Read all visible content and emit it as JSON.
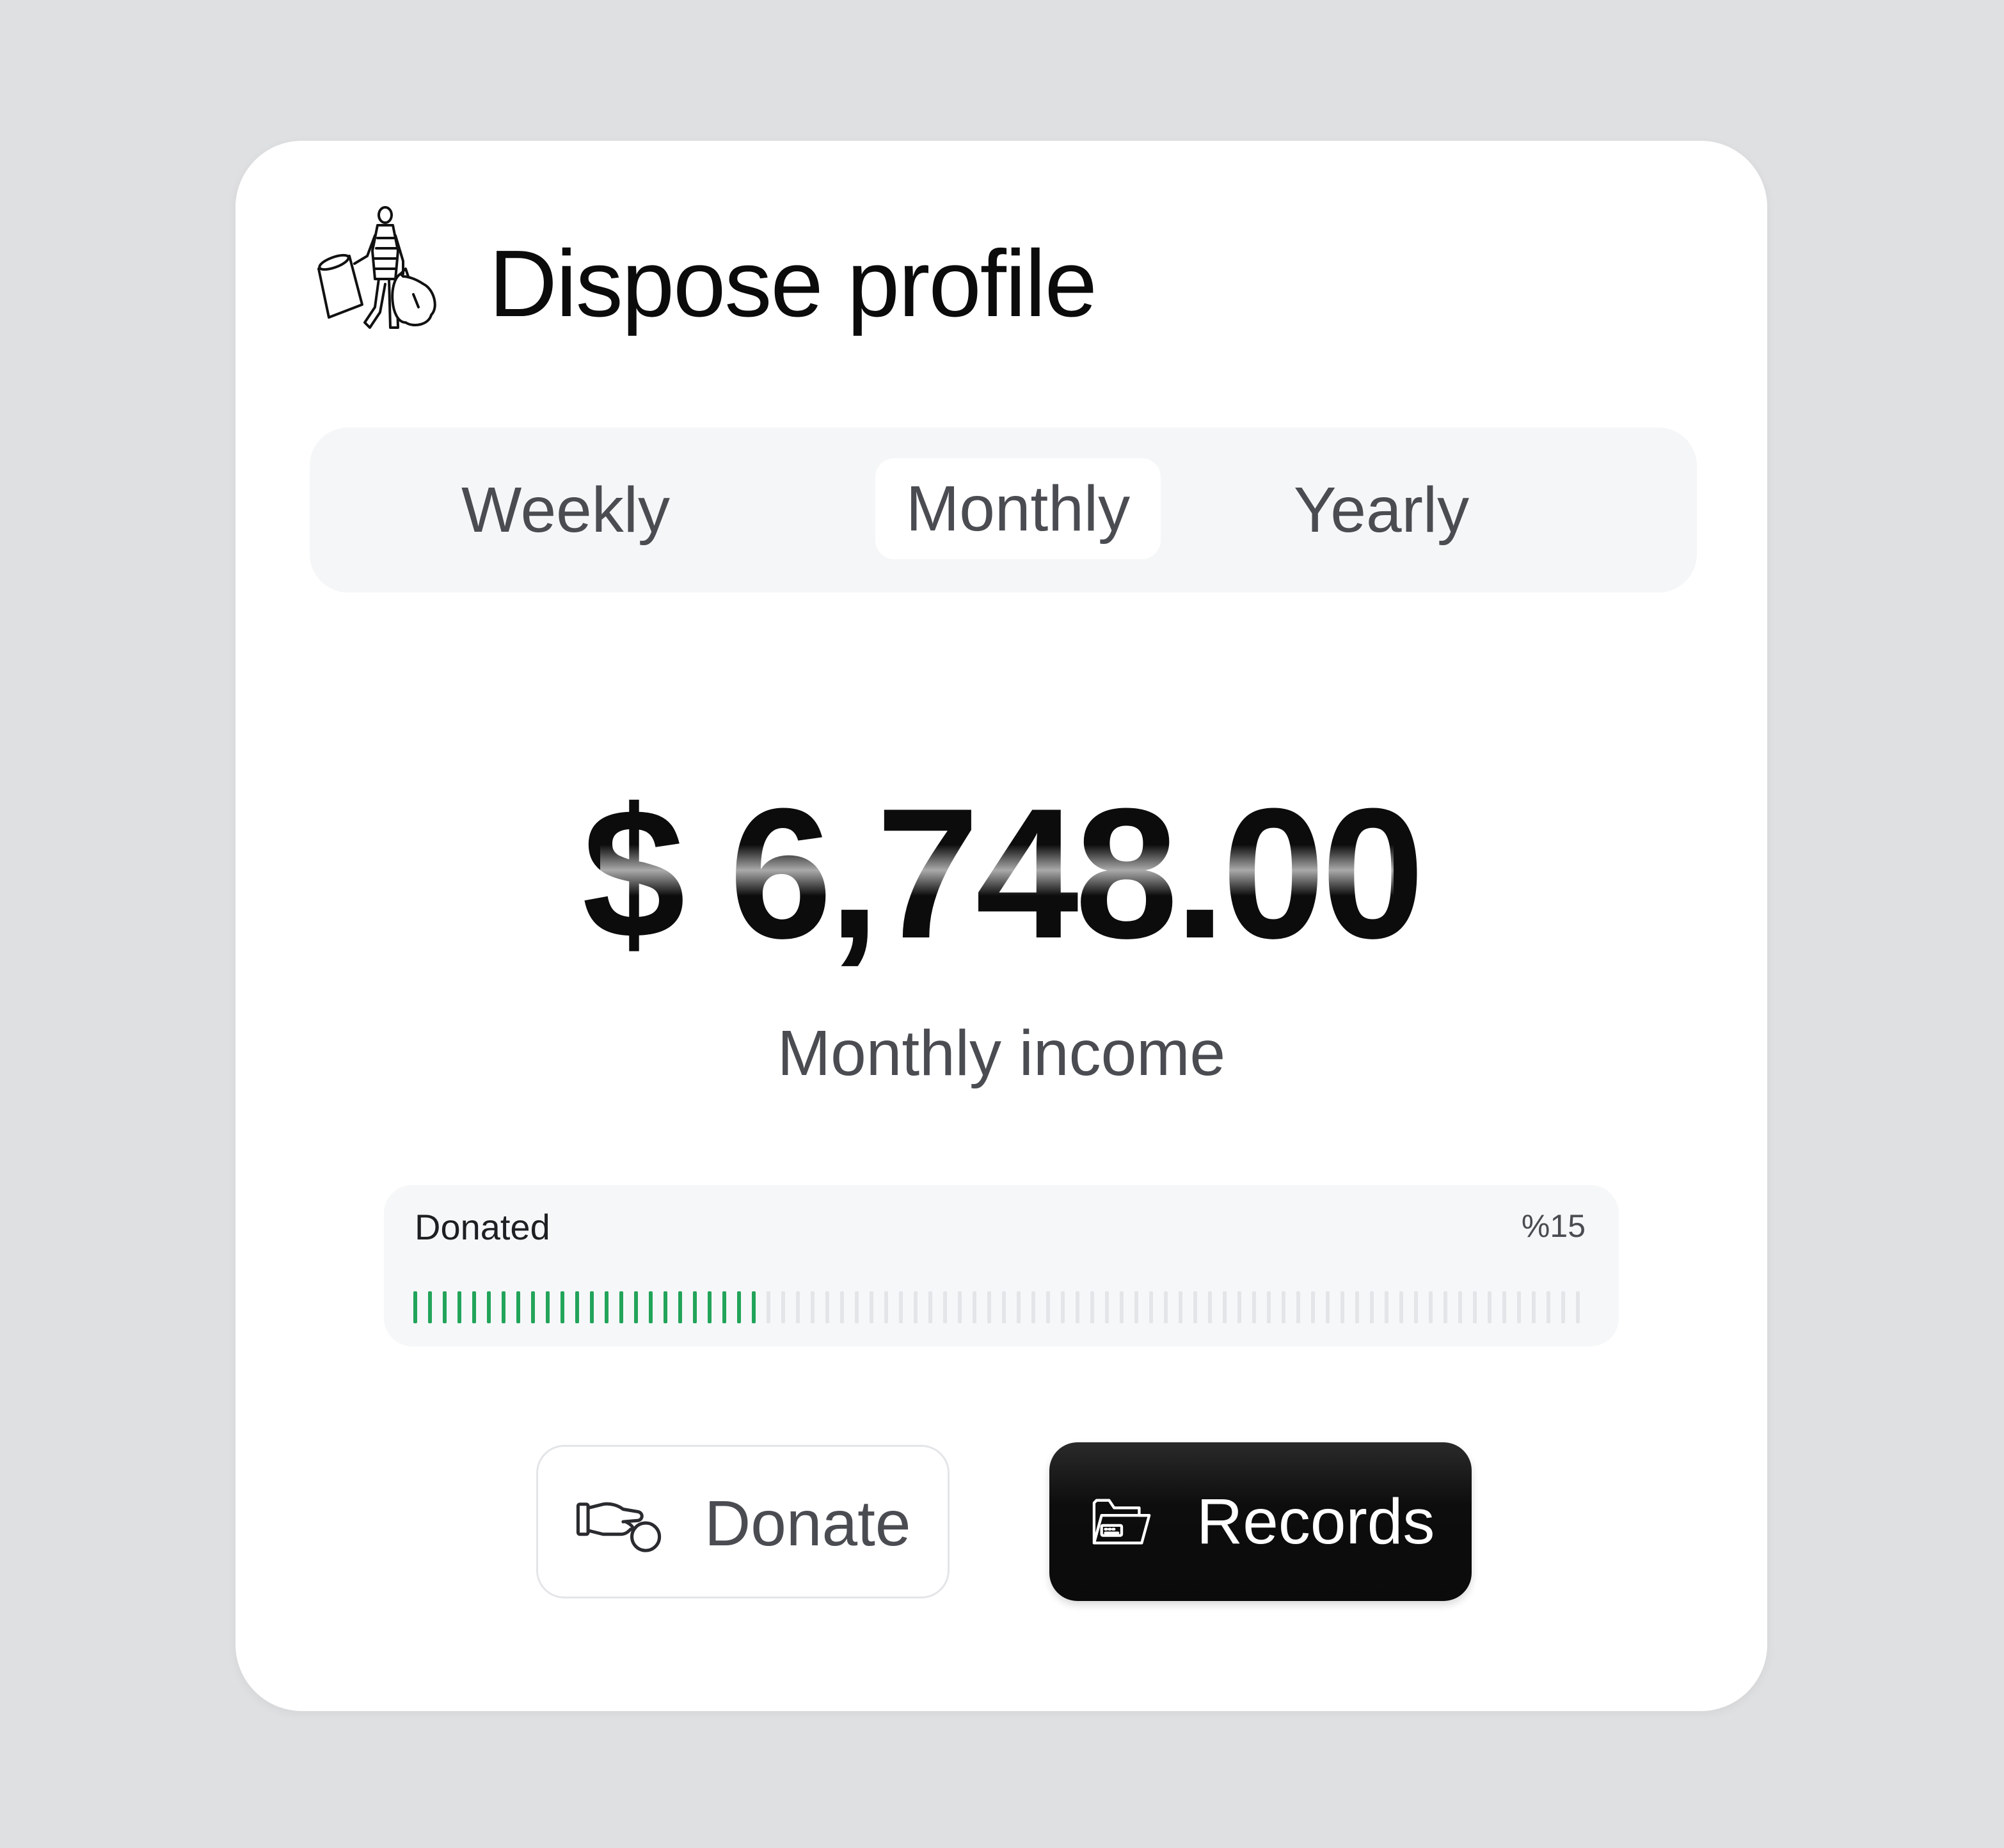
{
  "card": {
    "title": "Dispose profile",
    "header_icon": "person-carrying-trash-bags-icon"
  },
  "period_tabs": {
    "items": [
      {
        "label": "Weekly",
        "selected": false
      },
      {
        "label": "Monthly",
        "selected": true
      },
      {
        "label": "Yearly",
        "selected": false
      }
    ]
  },
  "income": {
    "amount": "$ 6,748.00",
    "caption": "Monthly income"
  },
  "donation": {
    "label": "Donated",
    "percent_text": "%15",
    "filled_fraction": 0.3,
    "filled_color": "#22a45a",
    "empty_color": "#e3e5e8"
  },
  "actions": {
    "donate": {
      "label": "Donate",
      "icon": "hand-giving-coin-icon"
    },
    "records": {
      "label": "Records",
      "icon": "folder-icon"
    }
  },
  "colors": {
    "background": "#dfe0e2",
    "card": "#ffffff",
    "primary_button": "#0b0b0b"
  }
}
